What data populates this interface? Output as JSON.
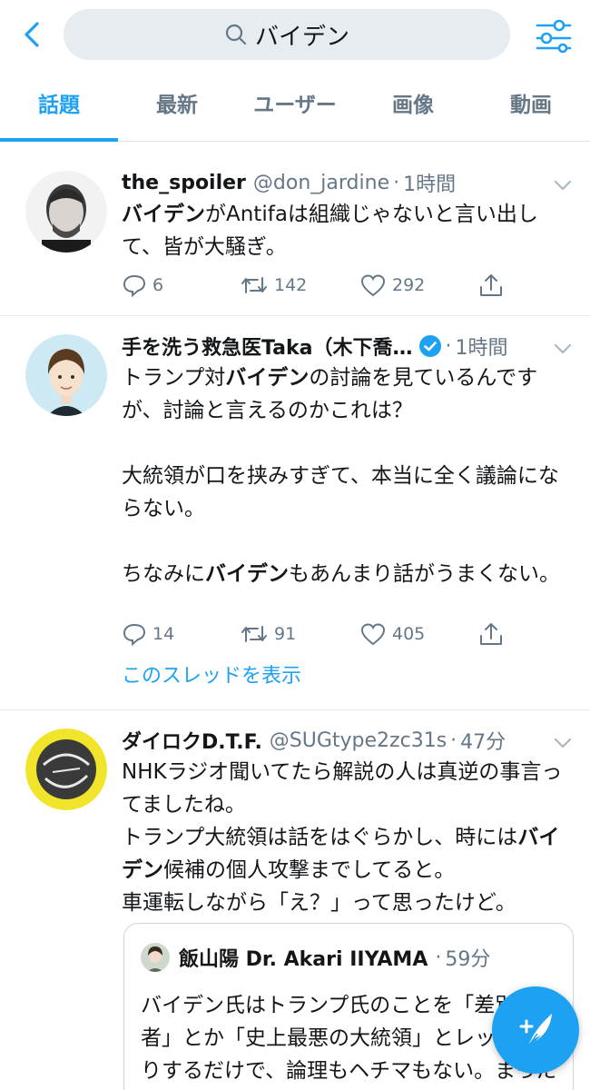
{
  "search": {
    "query": "バイデン"
  },
  "tabs": [
    {
      "label": "話題",
      "active": true
    },
    {
      "label": "最新",
      "active": false
    },
    {
      "label": "ユーザー",
      "active": false
    },
    {
      "label": "画像",
      "active": false
    },
    {
      "label": "動画",
      "active": false
    }
  ],
  "colors": {
    "accent": "#1da1f2",
    "muted": "#657786",
    "text": "#14171a"
  },
  "tweets": [
    {
      "name": "the_spoiler",
      "handle": "@don_jardine",
      "separator": "·",
      "time": "1時間",
      "text_parts": [
        {
          "t": "バイデン",
          "bold": true
        },
        {
          "t": "がAntifaは組織じゃないと言い出して、皆が大騒ぎ。",
          "bold": false
        }
      ],
      "replies": "6",
      "retweets": "142",
      "likes": "292"
    },
    {
      "name": "手を洗う救急医Taka（木下喬…",
      "verified": true,
      "separator": "·",
      "time": "1時間",
      "text_parts": [
        {
          "t": "トランプ対",
          "bold": false
        },
        {
          "t": "バイデン",
          "bold": true
        },
        {
          "t": "の討論を見ているんですが、討論と言えるのかこれは？",
          "bold": false
        },
        {
          "t": "\n\n大統領が口を挟みすぎて、本当に全く議論にならない。\n\nちなみに",
          "bold": false
        },
        {
          "t": "バイデン",
          "bold": true
        },
        {
          "t": "もあんまり話がうまくない。",
          "bold": false
        }
      ],
      "replies": "14",
      "retweets": "91",
      "likes": "405",
      "thread_link": "このスレッドを表示"
    },
    {
      "name": "ダイロクD.T.F.",
      "handle": "@SUGtype2zc31s",
      "separator": "·",
      "time": "47分",
      "text_parts": [
        {
          "t": "NHKラジオ聞いてたら解説の人は真逆の事言ってましたね。\nトランプ大統領は話をはぐらかし、時には",
          "bold": false
        },
        {
          "t": "バイデン",
          "bold": true
        },
        {
          "t": "候補の個人攻撃までしてると。\n車運転しながら「え？」って思ったけど。",
          "bold": false
        }
      ],
      "quote": {
        "name": "飯山陽 Dr. Akari IIYAMA",
        "separator": "·",
        "time": "59分",
        "text": "バイデン氏はトランプ氏のことを「差別主義者」とか「史上最悪の大統領」とレッテル貼りするだけで、論理もヘチマもない。まったくないし、トランプ氏の質問に対"
      }
    }
  ]
}
